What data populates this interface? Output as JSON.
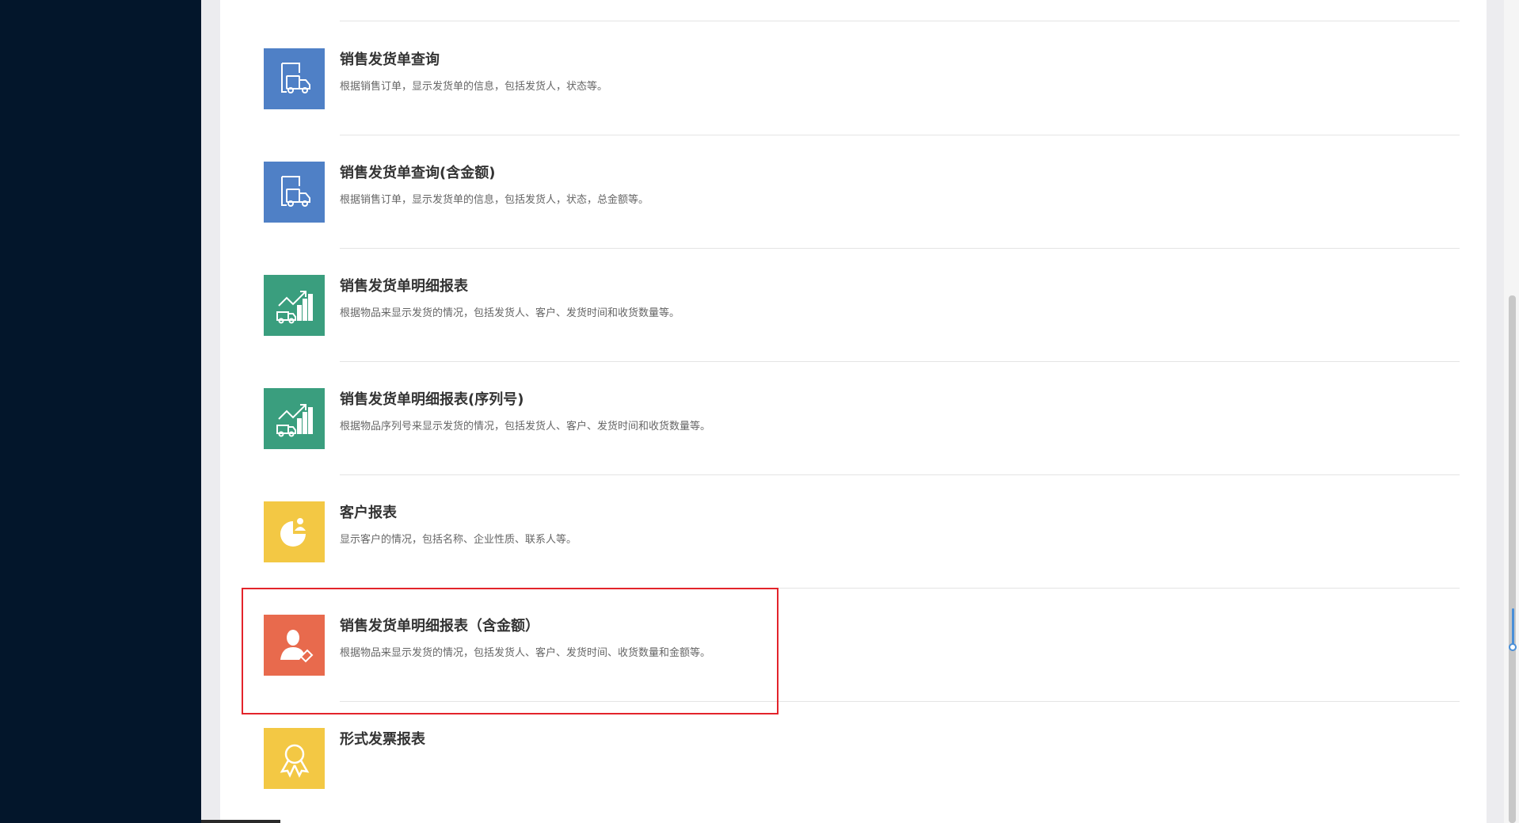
{
  "colors": {
    "sidebar": "#03162b",
    "blue_tile": "#4f80c6",
    "green_tile": "#3a9e7e",
    "yellow_tile": "#f3c844",
    "orange_tile": "#e86a4d",
    "highlight_border": "#e3242b"
  },
  "reports": [
    {
      "title": "销售发货单查询",
      "description": "根据销售订单，显示发货单的信息，包括发货人，状态等。",
      "icon": "truck-document-icon",
      "tile_color": "#4f80c6"
    },
    {
      "title": "销售发货单查询(含金额)",
      "description": "根据销售订单，显示发货单的信息，包括发货人，状态，总金额等。",
      "icon": "truck-document-icon",
      "tile_color": "#4f80c6"
    },
    {
      "title": "销售发货单明细报表",
      "description": "根据物品来显示发货的情况，包括发货人、客户、发货时间和收货数量等。",
      "icon": "truck-chart-icon",
      "tile_color": "#3a9e7e"
    },
    {
      "title": "销售发货单明细报表(序列号)",
      "description": "根据物品序列号来显示发货的情况，包括发货人、客户、发货时间和收货数量等。",
      "icon": "truck-chart-icon",
      "tile_color": "#3a9e7e"
    },
    {
      "title": "客户报表",
      "description": "显示客户的情况，包括名称、企业性质、联系人等。",
      "icon": "pie-chart-person-icon",
      "tile_color": "#f3c844"
    },
    {
      "title": "销售发货单明细报表（含金额）",
      "description": "根据物品来显示发货的情况，包括发货人、客户、发货时间、收货数量和金额等。",
      "icon": "person-tag-icon",
      "tile_color": "#e86a4d"
    },
    {
      "title": "形式发票报表",
      "description": "",
      "icon": "award-ribbon-icon",
      "tile_color": "#f3c844"
    }
  ]
}
